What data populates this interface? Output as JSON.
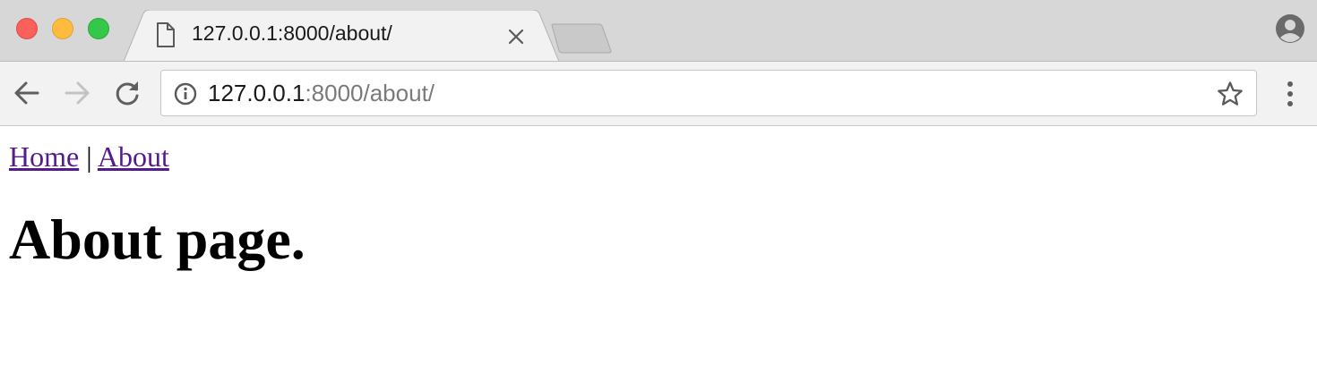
{
  "browser": {
    "tab": {
      "title": "127.0.0.1:8000/about/"
    },
    "address_bar": {
      "host": "127.0.0.1",
      "rest": ":8000/about/"
    },
    "icons": {
      "tab": "file-icon",
      "tab_close": "close-icon",
      "profile": "profile-icon",
      "back": "back-arrow-icon",
      "forward": "forward-arrow-icon",
      "reload": "reload-icon",
      "info": "info-icon",
      "bookmark": "star-icon",
      "menu": "more-vertical-icon"
    },
    "colors": {
      "traffic_close": "#fc605b",
      "traffic_minimize": "#fdbc40",
      "traffic_maximize": "#34c84a",
      "visited_link": "#551a8b"
    }
  },
  "page": {
    "nav": {
      "home_label": "Home",
      "separator": "|",
      "about_label": "About"
    },
    "heading": "About page."
  }
}
